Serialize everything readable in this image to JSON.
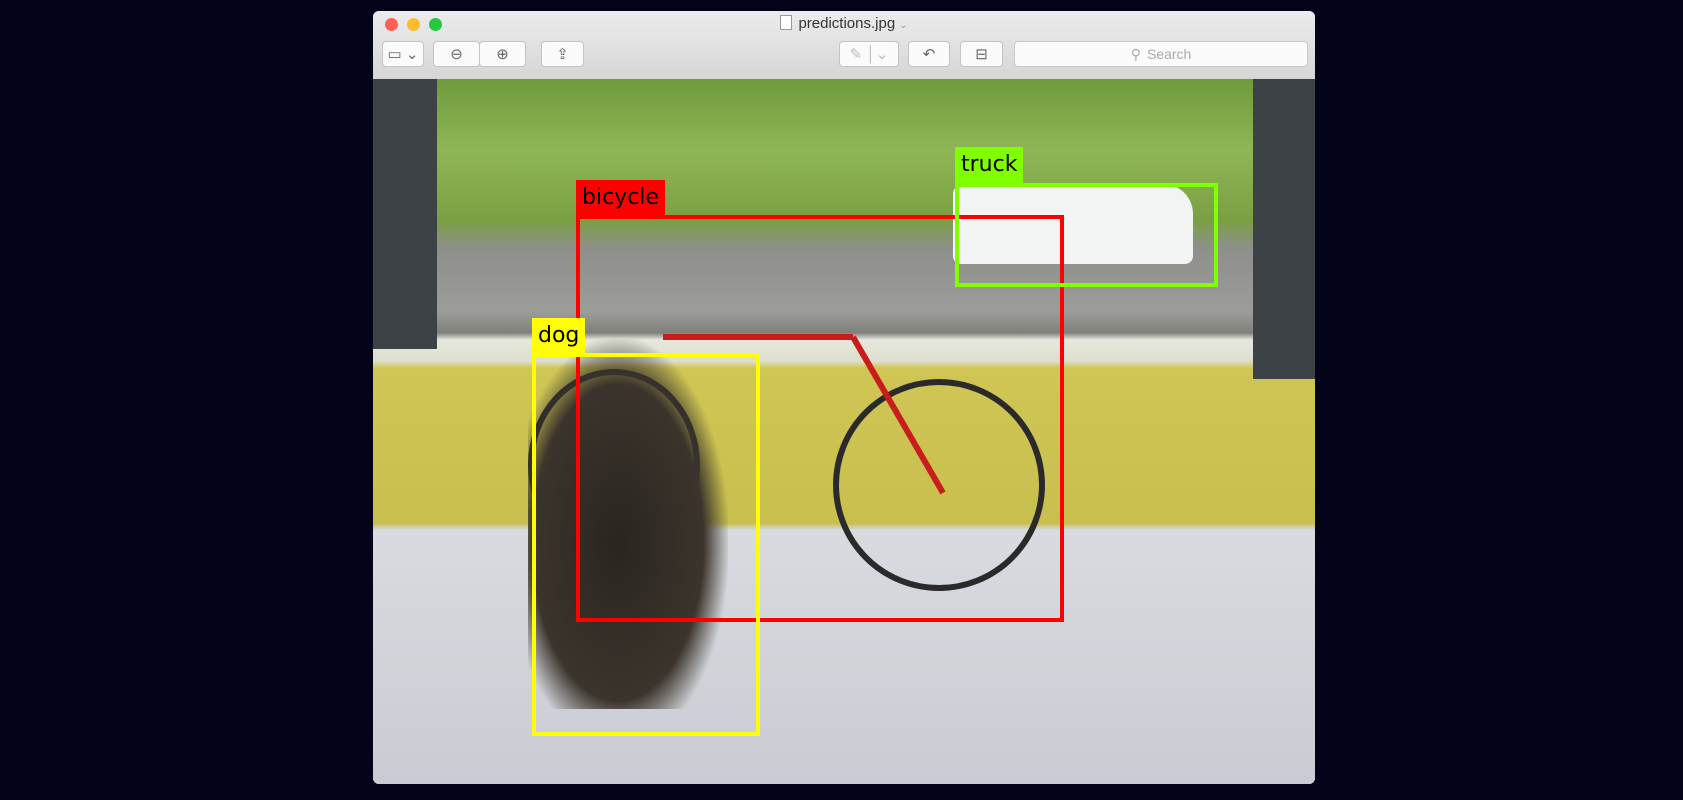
{
  "window": {
    "title": "predictions.jpg",
    "traffic_lights": {
      "close": "#fe5f57",
      "minimize": "#febc2e",
      "zoom": "#28c840"
    }
  },
  "toolbar": {
    "sidebar_icon": "sidebar-icon",
    "zoom_out_icon": "zoom-out-icon",
    "zoom_in_icon": "zoom-in-icon",
    "share_icon": "share-icon",
    "markup_icon": "markup-pen-icon",
    "rotate_icon": "rotate-icon",
    "toolbox_icon": "toolbox-icon",
    "search_placeholder": "Search"
  },
  "detections": [
    {
      "label": "bicycle",
      "color": "#ff0000"
    },
    {
      "label": "truck",
      "color": "#80ff00"
    },
    {
      "label": "dog",
      "color": "#ffff00"
    }
  ]
}
